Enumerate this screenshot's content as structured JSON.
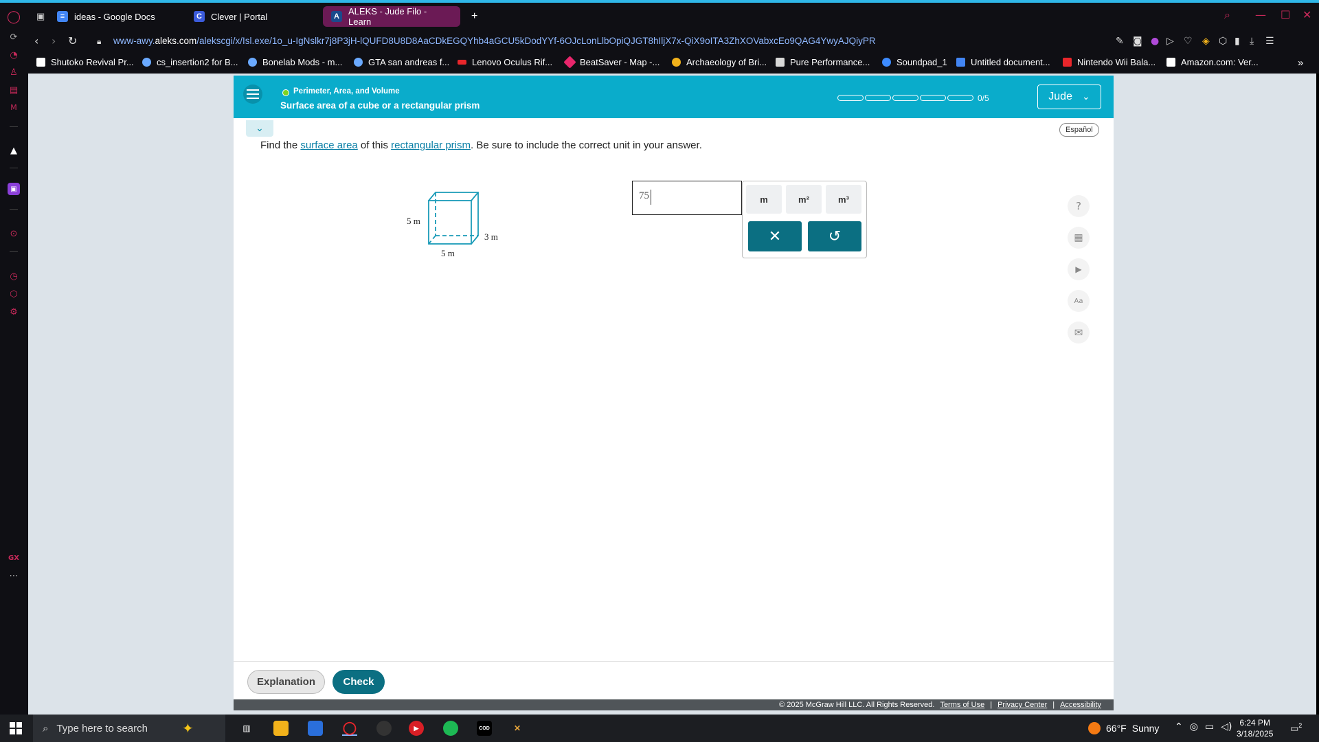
{
  "browser": {
    "tabs": [
      {
        "label": "ideas - Google Docs",
        "icon": "google-docs-icon",
        "color": "#4285f4",
        "active": false
      },
      {
        "label": "Clever | Portal",
        "icon": "clever-icon",
        "color": "#3b5bdb",
        "active": false
      },
      {
        "label": "ALEKS - Jude Filo - Learn",
        "icon": "aleks-icon",
        "color": "#1b4a8c",
        "active": true
      }
    ],
    "new_tab": "+",
    "url_prefix": "www-awy.",
    "url_host": "aleks.com",
    "url_path": "/alekscgi/x/Isl.exe/1o_u-IgNslkr7j8P3jH-lQUFD8U8D8AaCDkEGQYhb4aGCU5kDodYYf-6OJcLonLlbOpiQJGT8hIljX7x-QiX9oITA3ZhXOVabxcEo9QAG4YwyAJQiyPR",
    "bookmarks": [
      {
        "label": "Shutoko Revival Pr...",
        "color": "#ffffff"
      },
      {
        "label": "cs_insertion2 for B...",
        "color": "#6aa9ff"
      },
      {
        "label": "Bonelab Mods - m...",
        "color": "#6aa9ff"
      },
      {
        "label": "GTA san andreas f...",
        "color": "#6aa9ff"
      },
      {
        "label": "Lenovo Oculus Rif...",
        "color": "#e8262b"
      },
      {
        "label": "BeatSaver - Map -...",
        "color": "#e8266c"
      },
      {
        "label": "Archaeology of Bri...",
        "color": "#f2b21b"
      },
      {
        "label": "Pure Performance...",
        "color": "#d8d8d8"
      },
      {
        "label": "Soundpad_1",
        "color": "#3d8bff"
      },
      {
        "label": "Untitled document...",
        "color": "#4285f4"
      },
      {
        "label": "Nintendo Wii Bala...",
        "color": "#e8262b"
      },
      {
        "label": "Amazon.com: Ver...",
        "color": "#ffffff"
      }
    ],
    "bookmarks_more": "»"
  },
  "aleks": {
    "topic": "Perimeter, Area, and Volume",
    "title": "Surface area of a cube or a rectangular prism",
    "progress_label": "0/5",
    "progress_segments": 5,
    "progress_filled": 0,
    "user": "Jude",
    "espanol": "Español",
    "question": {
      "before": "Find the ",
      "link1": "surface area",
      "middle": " of this ",
      "link2": "rectangular prism",
      "after": ". Be sure to include the correct unit in your answer."
    },
    "figure": {
      "height": "5 m",
      "width": "5 m",
      "depth": "3 m"
    },
    "answer_value": "75",
    "units": [
      "m",
      "m²",
      "m³"
    ],
    "clear_symbol": "✕",
    "undo_symbol": "↺",
    "tools": [
      "help-icon",
      "calculator-icon",
      "video-icon",
      "textbook-icon",
      "mail-icon"
    ],
    "tool_glyphs": [
      "?",
      "▦",
      "▶",
      "Aa",
      "✉"
    ],
    "explanation_label": "Explanation",
    "check_label": "Check",
    "copyright": "© 2025 McGraw Hill LLC. All Rights Reserved.",
    "terms": "Terms of Use",
    "privacy": "Privacy Center",
    "accessibility": "Accessibility",
    "separator": "|",
    "header_color": "#0aaccb",
    "button_color": "#0b6f82"
  },
  "taskbar": {
    "search_placeholder": "Type here to search",
    "weather_temp": "66°F",
    "weather_desc": "Sunny",
    "time": "6:24 PM",
    "date": "3/18/2025",
    "notifications": "2"
  }
}
